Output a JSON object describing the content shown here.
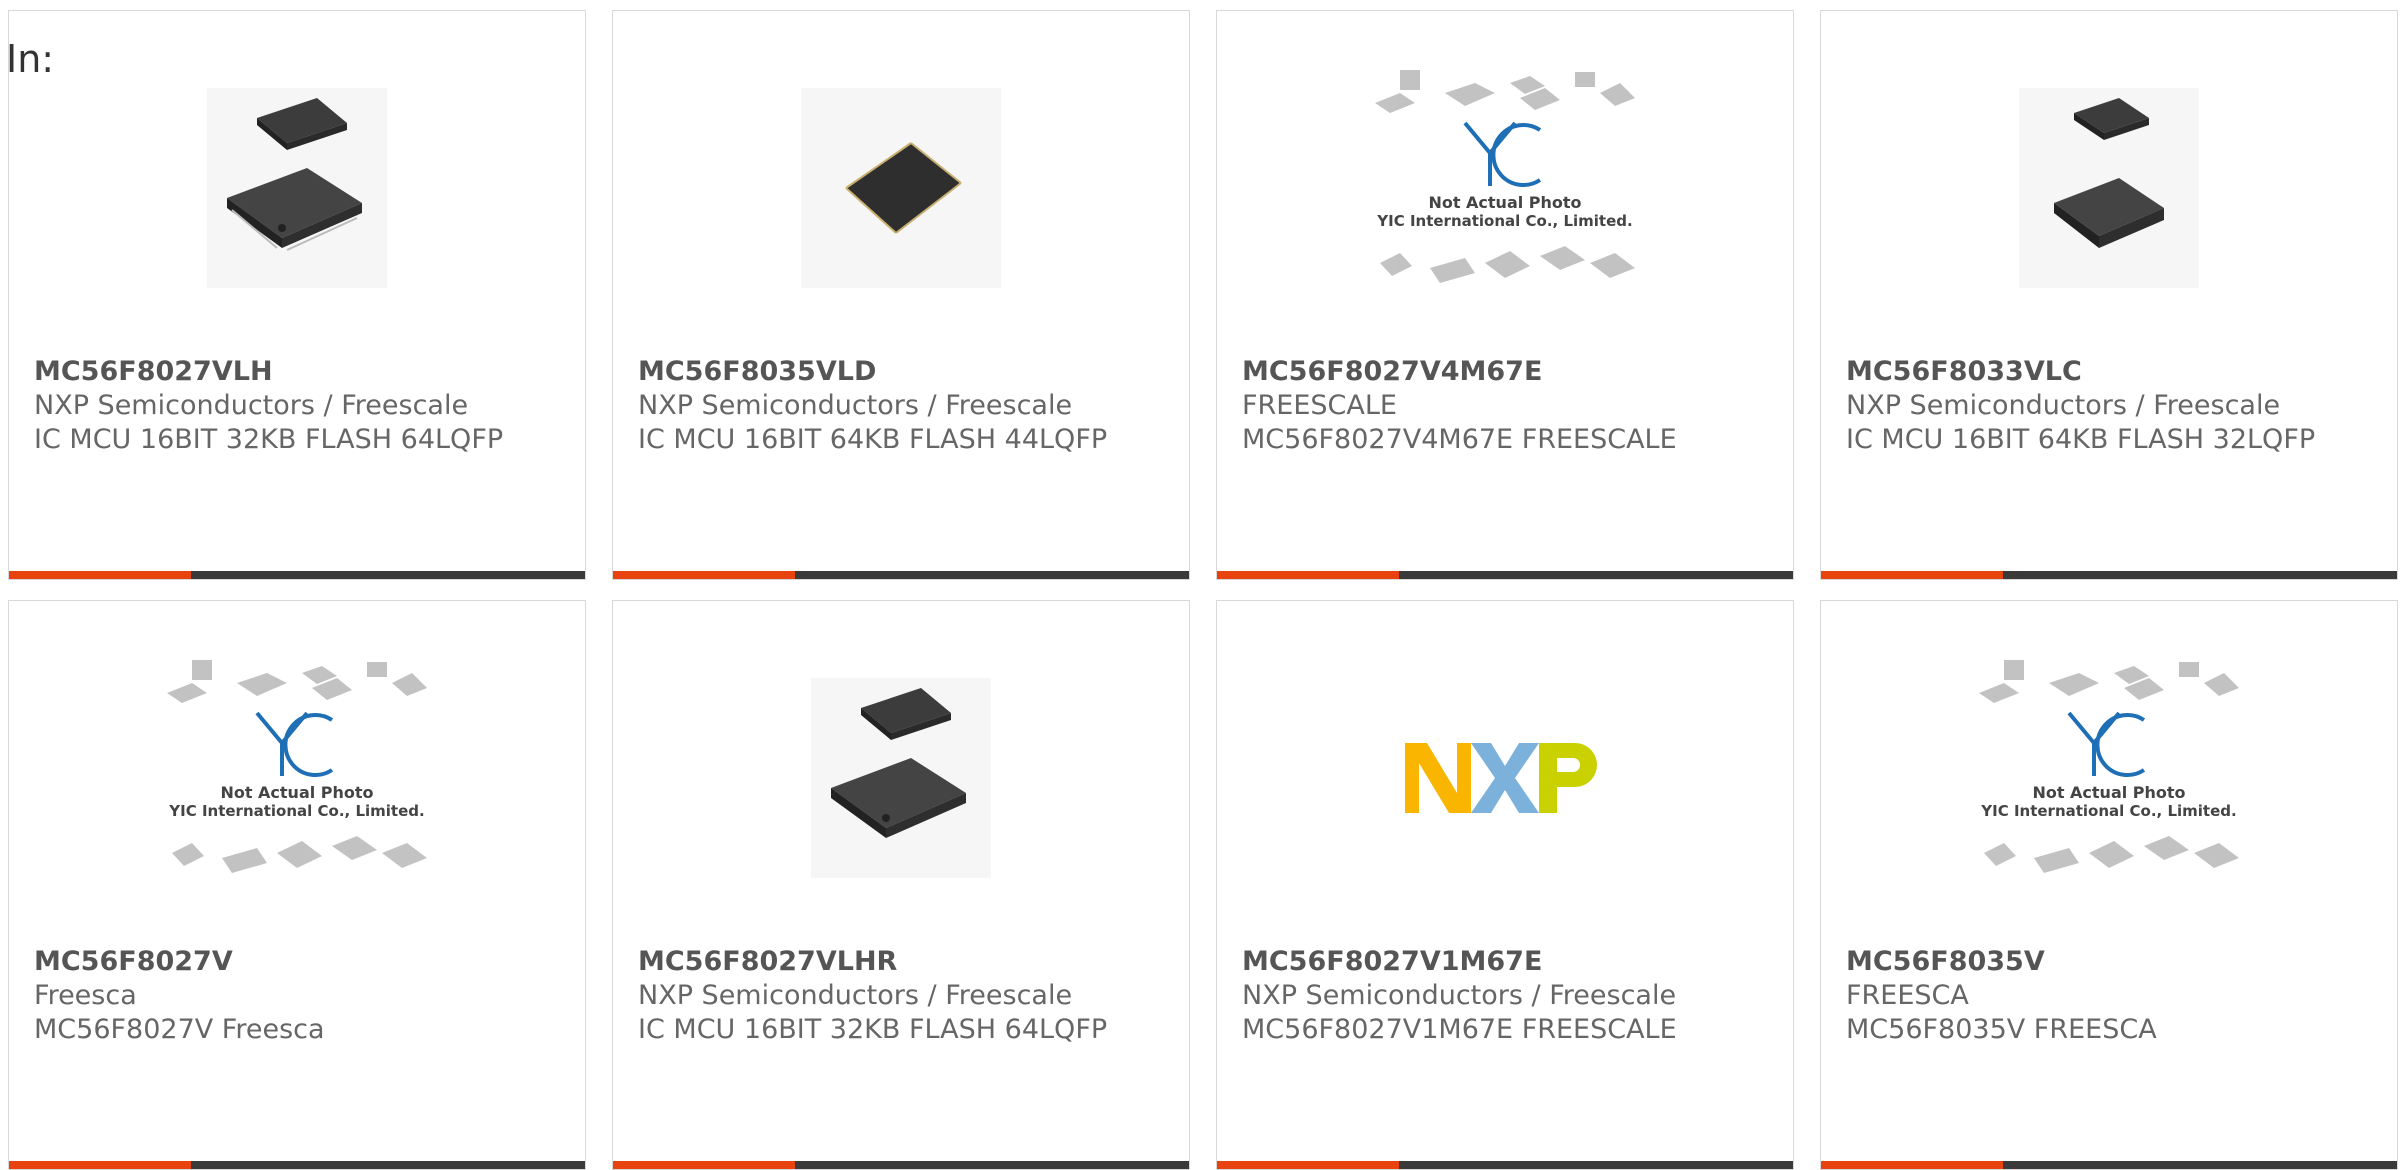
{
  "filter_label": "In:",
  "colors": {
    "accent": "#e8420f",
    "bar": "#3a3a3a",
    "title": "#555555",
    "body": "#666666"
  },
  "products": [
    {
      "part": "MC56F8027VLH",
      "maker": "NXP Semiconductors / Freescale",
      "desc": "IC MCU 16BIT 32KB FLASH 64LQFP",
      "image": "qfp-chip-pair-icon"
    },
    {
      "part": "MC56F8035VLD",
      "maker": "NXP Semiconductors / Freescale",
      "desc": "IC MCU 16BIT 64KB FLASH 44LQFP",
      "image": "single-qfp-chip-icon"
    },
    {
      "part": "MC56F8027V4M67E",
      "maker": "FREESCALE",
      "desc": "MC56F8027V4M67E FREESCALE",
      "image": "yic-placeholder",
      "placeholder": {
        "line1": "Not Actual Photo",
        "line2": "YIC International Co., Limited."
      }
    },
    {
      "part": "MC56F8033VLC",
      "maker": "NXP Semiconductors / Freescale",
      "desc": "IC MCU 16BIT 64KB FLASH 32LQFP",
      "image": "qfp-chip-pair-icon"
    },
    {
      "part": "MC56F8027V",
      "maker": "Freesca",
      "desc": "MC56F8027V Freesca",
      "image": "yic-placeholder",
      "placeholder": {
        "line1": "Not Actual Photo",
        "line2": "YIC International Co., Limited."
      }
    },
    {
      "part": "MC56F8027VLHR",
      "maker": "NXP Semiconductors / Freescale",
      "desc": "IC MCU 16BIT 32KB FLASH 64LQFP",
      "image": "qfp-chip-pair-icon"
    },
    {
      "part": "MC56F8027V1M67E",
      "maker": "NXP Semiconductors / Freescale",
      "desc": "MC56F8027V1M67E FREESCALE",
      "image": "nxp-logo"
    },
    {
      "part": "MC56F8035V",
      "maker": "FREESCA",
      "desc": "MC56F8035V FREESCA",
      "image": "yic-placeholder",
      "placeholder": {
        "line1": "Not Actual Photo",
        "line2": "YIC International Co., Limited."
      }
    }
  ]
}
